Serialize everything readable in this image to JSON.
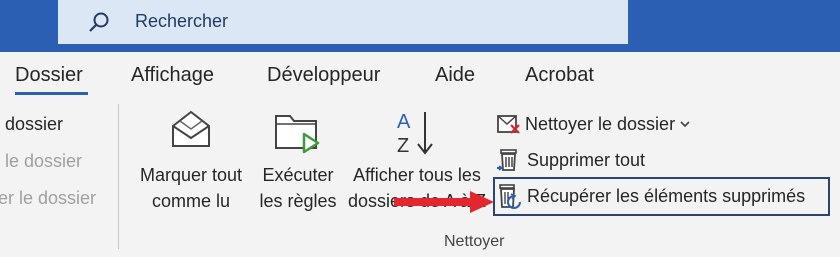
{
  "search": {
    "placeholder_text": "Rechercher",
    "icon": "search-icon"
  },
  "tabs": [
    {
      "label": "Dossier",
      "active": true
    },
    {
      "label": "Affichage",
      "active": false
    },
    {
      "label": "Développeur",
      "active": false
    },
    {
      "label": "Aide",
      "active": false
    },
    {
      "label": "Acrobat",
      "active": false
    }
  ],
  "left_items": [
    {
      "label": "dossier",
      "enabled": true
    },
    {
      "label": "le dossier",
      "enabled": false
    },
    {
      "label": "er le dossier",
      "enabled": false
    }
  ],
  "big_buttons": [
    {
      "line1": "Marquer tout",
      "line2": "comme lu",
      "icon": "envelope-open-icon"
    },
    {
      "line1": "Exécuter",
      "line2": "les règles",
      "icon": "folder-run-icon"
    },
    {
      "line1": "Afficher tous les",
      "line2": "dossiers de A à Z",
      "icon": "sort-az-icon"
    }
  ],
  "small_buttons": [
    {
      "label": "Nettoyer le dossier",
      "icon": "cleanup-folder-icon",
      "has_dropdown": true
    },
    {
      "label": "Supprimer tout",
      "icon": "delete-all-icon",
      "has_dropdown": false
    },
    {
      "label": "Récupérer les éléments supprimés",
      "icon": "recover-deleted-icon",
      "has_dropdown": false
    }
  ],
  "group_label": "Nettoyer",
  "colors": {
    "titlebar": "#2b5fb4",
    "search_bg": "#dce7f6",
    "arrow": "#e3262f",
    "highlight": "#2e4470"
  }
}
